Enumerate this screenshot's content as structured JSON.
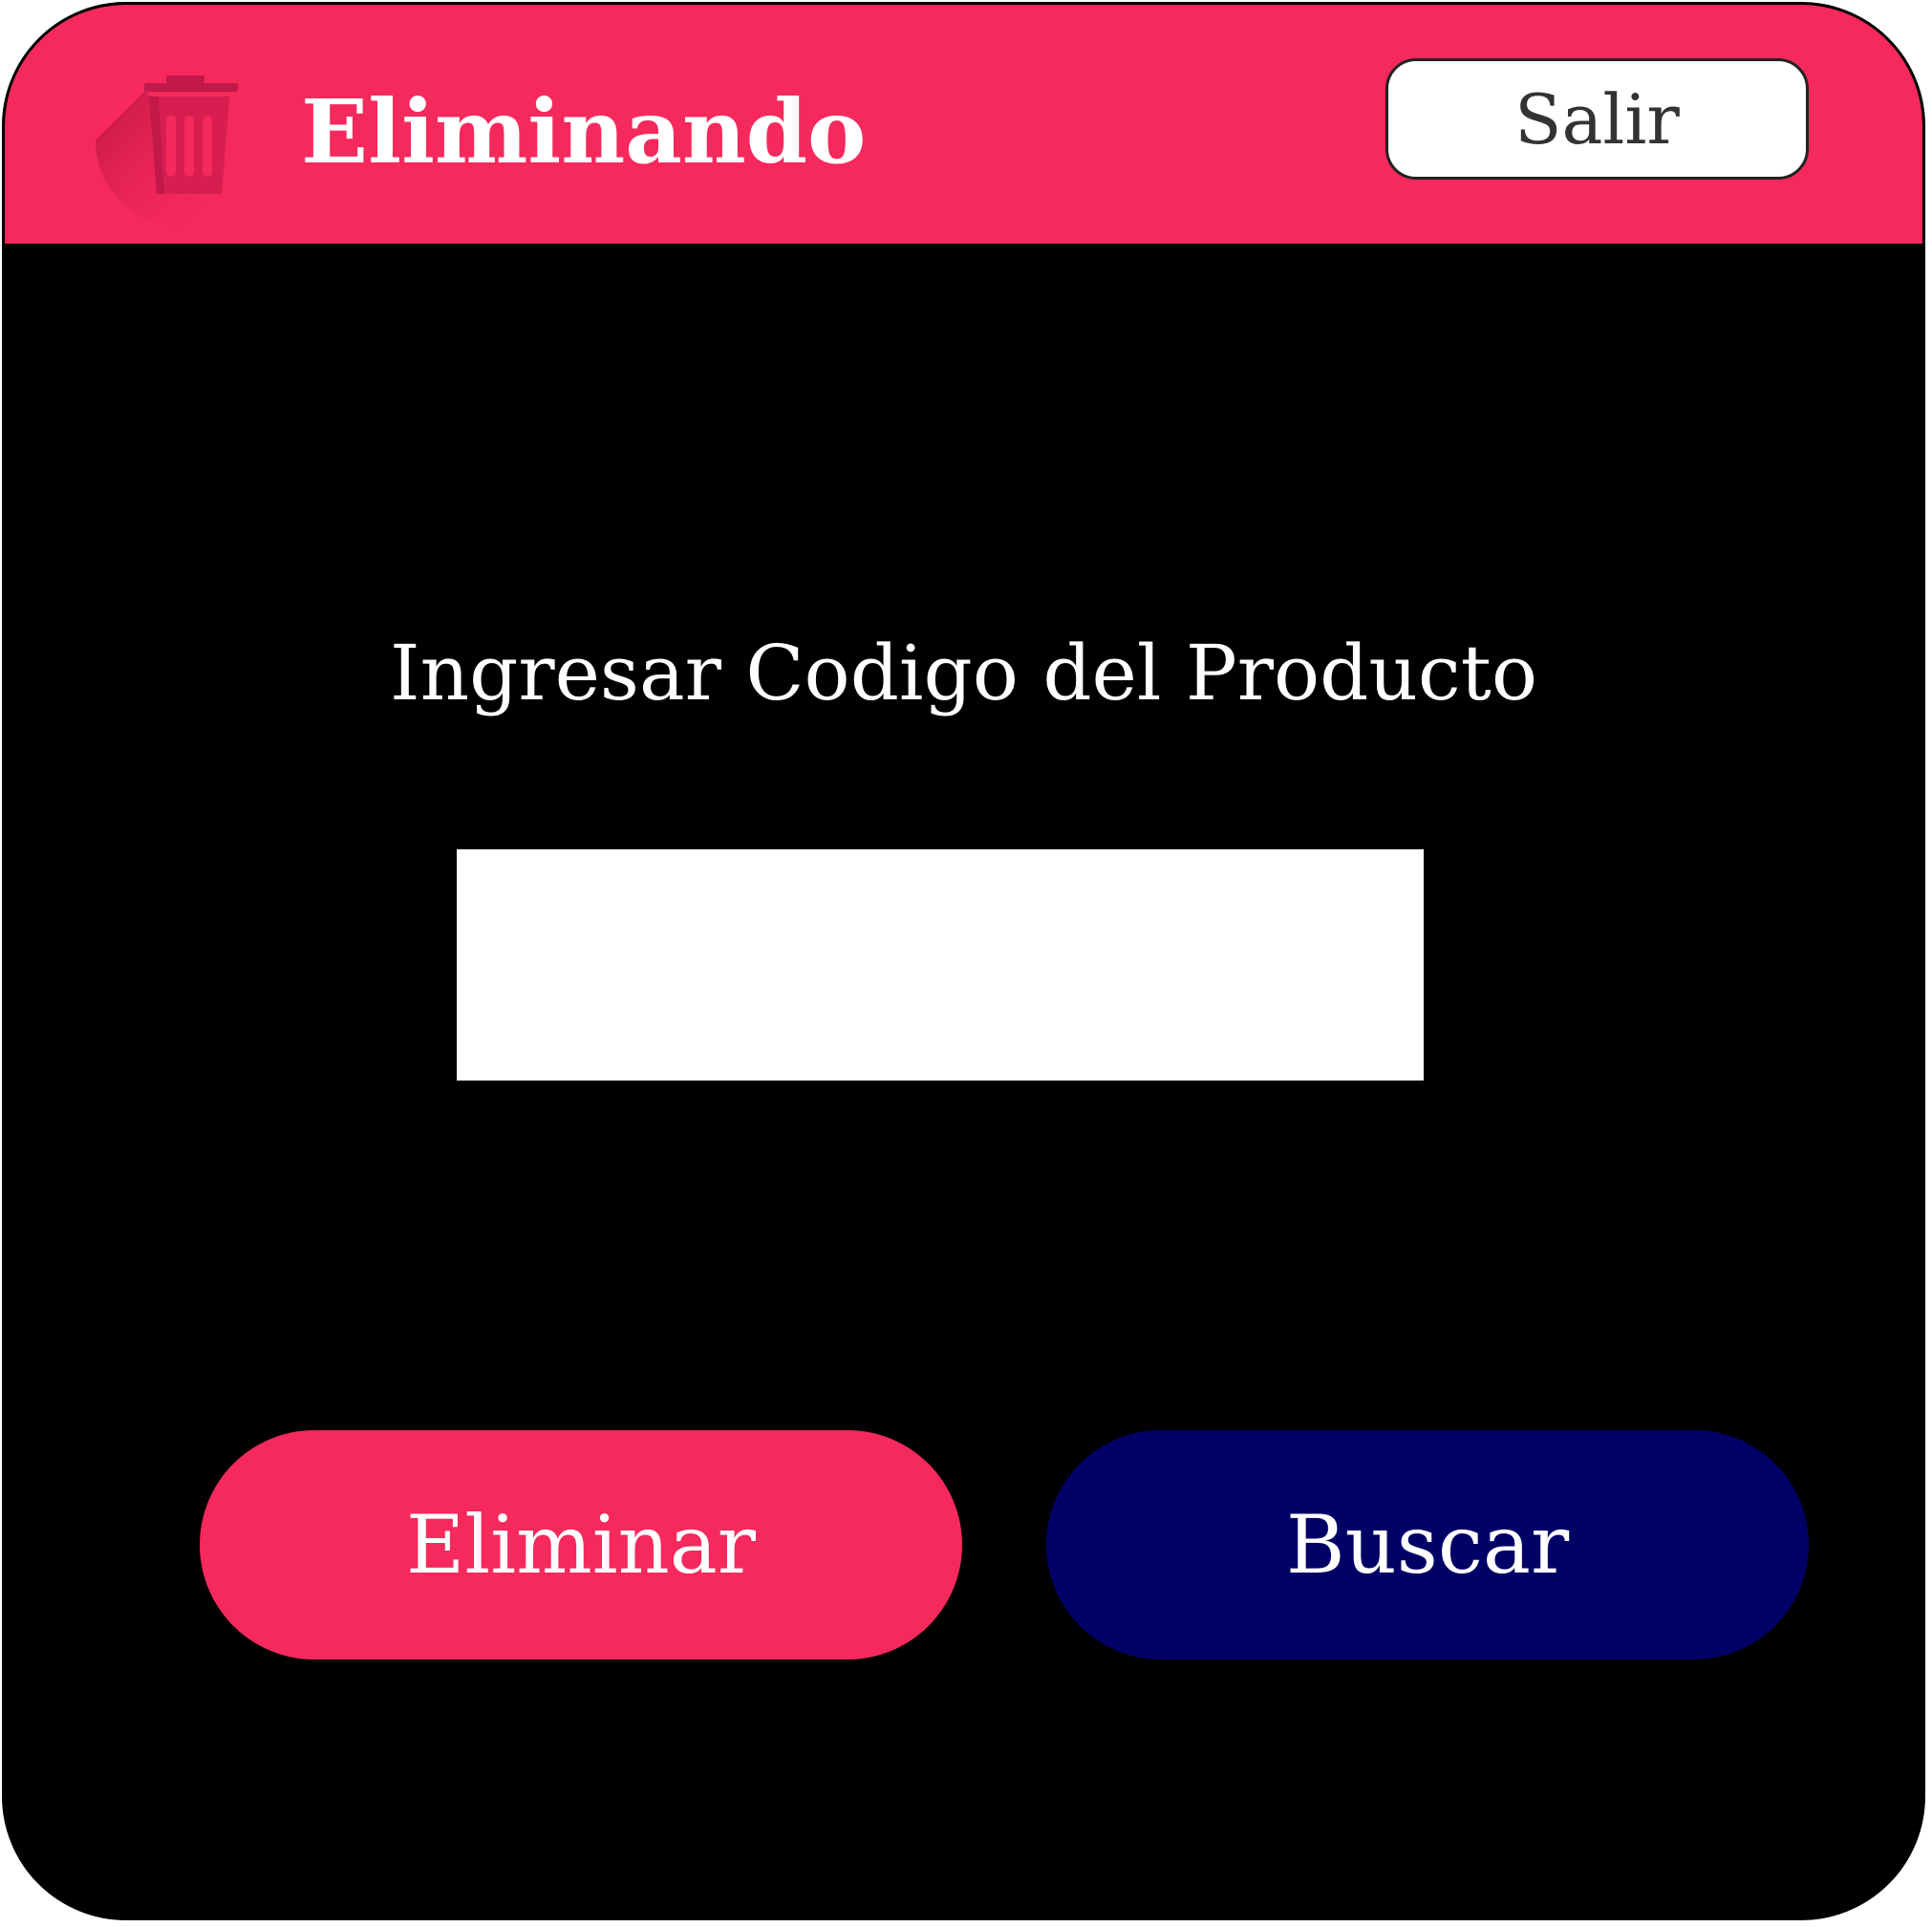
{
  "window": {
    "title": "Eliminando",
    "exit_label": "Salir"
  },
  "form": {
    "prompt": "Ingresar Codigo del Producto",
    "code_value": "",
    "code_placeholder": ""
  },
  "actions": {
    "delete_label": "Eliminar",
    "search_label": "Buscar"
  },
  "icons": {
    "title_icon": "trash-icon"
  },
  "colors": {
    "accent": "#f5295c",
    "search_button": "#000066",
    "background": "#000000",
    "text_light": "#ffffff"
  }
}
